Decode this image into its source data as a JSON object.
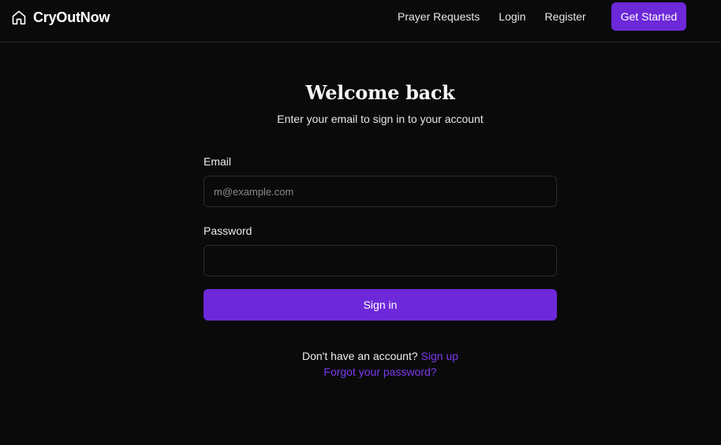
{
  "nav": {
    "brand": "CryOutNow",
    "brand_icon": "home-icon",
    "links": [
      "Prayer Requests",
      "Login",
      "Register"
    ],
    "cta": "Get Started"
  },
  "auth": {
    "title": "Welcome back",
    "subtitle": "Enter your email to sign in to your account",
    "email_label": "Email",
    "email_placeholder": "m@example.com",
    "email_value": "",
    "password_label": "Password",
    "password_value": "",
    "submit": "Sign in",
    "no_account": "Don't have an account?",
    "signup": "Sign up",
    "forgot": "Forgot your password?"
  },
  "colors": {
    "background": "#0b0a0a",
    "accent": "#6d28d9",
    "link": "#7c3aed",
    "border": "#2b2b2b"
  }
}
